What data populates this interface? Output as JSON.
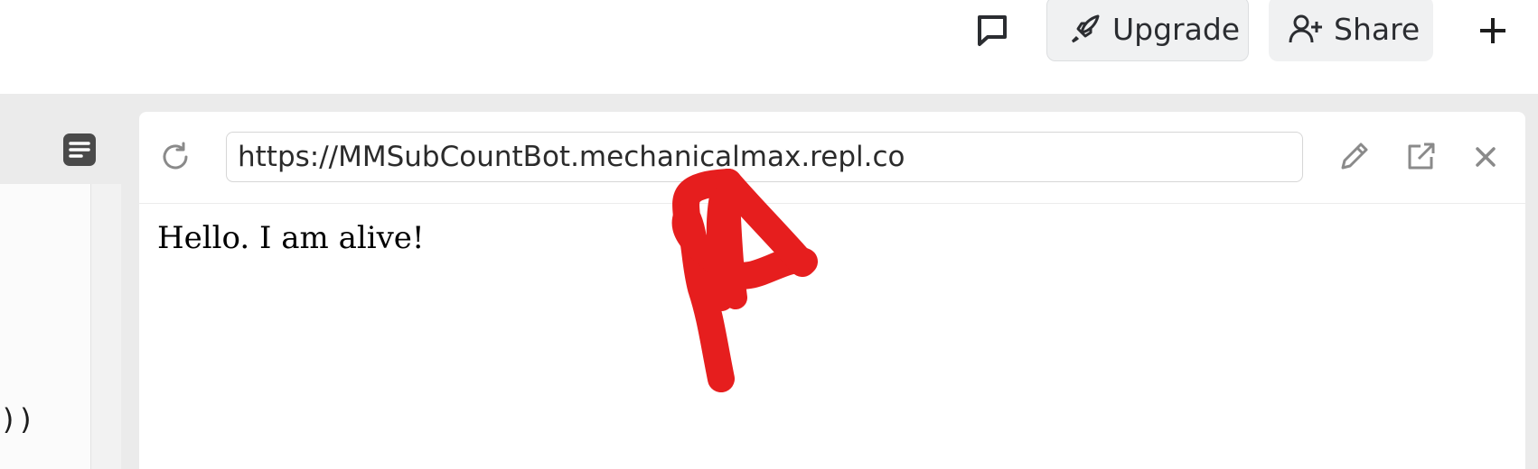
{
  "topbar": {
    "upgrade_label": "Upgrade",
    "share_label": "Share"
  },
  "editor": {
    "visible_code_fragment": "))"
  },
  "webview": {
    "url": "https://MMSubCountBot.mechanicalmax.repl.co",
    "content_text": "Hello. I am alive!"
  },
  "icons": {
    "chat": "chat-bubble-icon",
    "upgrade": "rocket-icon",
    "share": "user-plus-icon",
    "add": "plus-icon",
    "outline": "outline-icon",
    "reload": "reload-icon",
    "edit": "pencil-icon",
    "open_external": "external-link-icon",
    "close": "close-icon"
  },
  "colors": {
    "annotation_arrow": "#e61e1e",
    "button_bg": "#f0f1f2",
    "workspace_bg": "#ebebeb"
  }
}
